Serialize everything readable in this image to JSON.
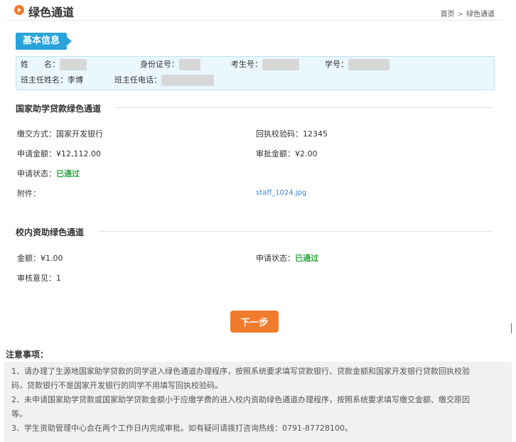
{
  "header": {
    "title": "绿色通道",
    "breadcrumb": [
      "首页",
      "绿色通道"
    ],
    "breadcrumb_sep": ">"
  },
  "basic_info": {
    "tag": "基本信息",
    "name_label": "姓　　名：",
    "id_label": "身份证号：",
    "exam_label": "考生号：",
    "student_label": "学号：",
    "teacher_label": "班主任姓名：",
    "teacher_value": "李博",
    "teacher_phone_label": "班主任电话："
  },
  "loan_section": {
    "title": "国家助学贷款绿色通道",
    "pay_method_label": "缴交方式：",
    "pay_method_value": "国家开发银行",
    "receipt_code_label": "回执校验码：",
    "receipt_code_value": "12345",
    "apply_amount_label": "申请金额：",
    "apply_amount_value": "¥12,112.00",
    "approve_amount_label": "审批金额：",
    "approve_amount_value": "¥2.00",
    "status_label": "申请状态：",
    "status_value": "已通过",
    "attachment_label": "附件：",
    "attachment_value": "staff_1024.jpg"
  },
  "school_section": {
    "title": "校内资助绿色通道",
    "amount_label": "金额：",
    "amount_value": "¥1.00",
    "status_label": "申请状态：",
    "status_value": "已通过",
    "opinion_label": "审核意见：",
    "opinion_value": "1"
  },
  "next_button": "下一步",
  "notice": {
    "title": "注意事项：",
    "items": [
      "1、请办理了生源地国家助学贷款的同学进入绿色通道办理程序，按照系统要求填写贷款银行、贷款金额和国家开发银行贷款回执校验",
      "码，贷款银行不是国家开发银行的同学不用填写回执校验码。",
      "2、未申请国家助学贷款或国家助学贷款金额小于应缴学费的进入校内资助绿色通道办理程序，按照系统要求填写缴交金额、缴交原因",
      "等。",
      "3、学生资助管理中心会在两个工作日内完成审批。如有疑问请拨打咨询热线：0791-87728100。"
    ]
  },
  "colors": {
    "accent": "#f07b2c",
    "tag_blue": "#2aa3da",
    "success": "#2ba63f",
    "info_bg": "#eaf7fd"
  }
}
